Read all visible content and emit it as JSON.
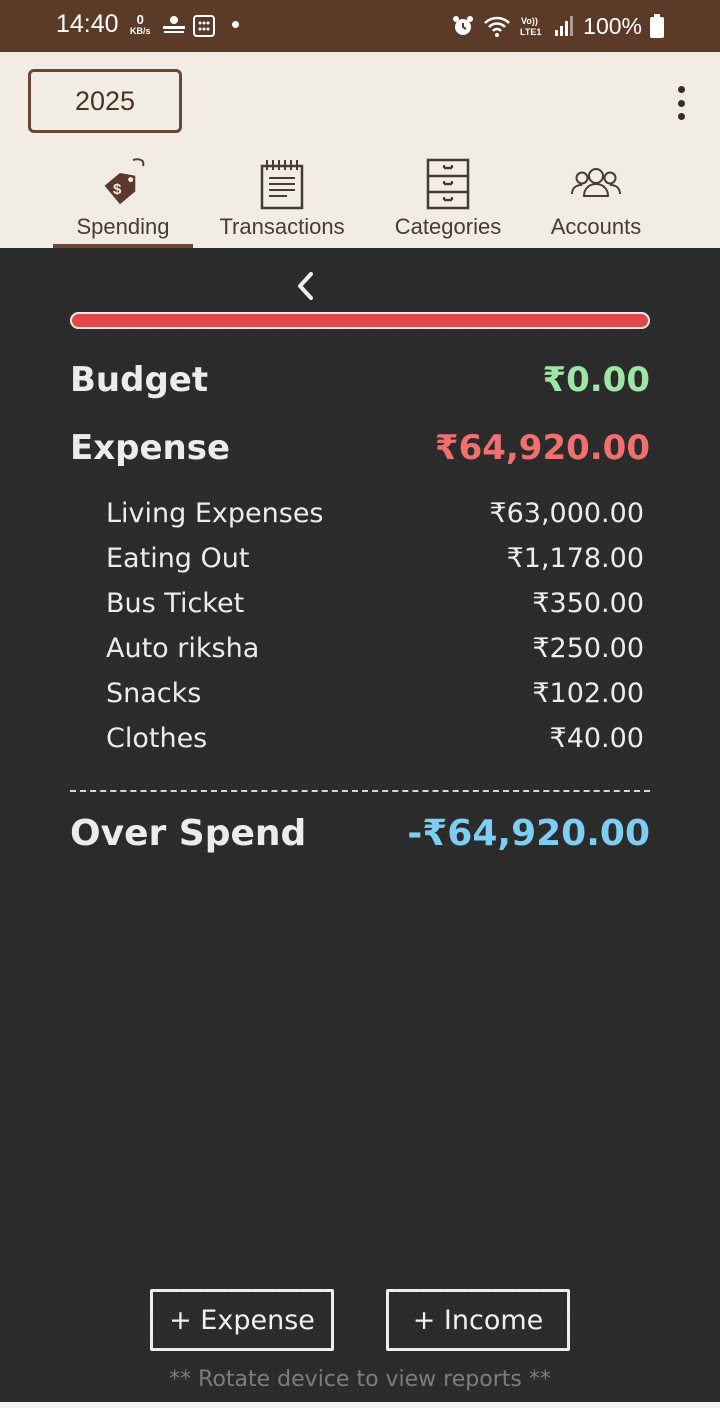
{
  "status": {
    "time": "14:40",
    "net_speed_value": "0",
    "net_speed_unit": "KB/s",
    "battery": "100%"
  },
  "header": {
    "year": "2025",
    "tabs": [
      {
        "label": "Spending",
        "icon": "price-tag-icon",
        "active": true
      },
      {
        "label": "Transactions",
        "icon": "notepad-icon",
        "active": false
      },
      {
        "label": "Categories",
        "icon": "drawers-icon",
        "active": false
      },
      {
        "label": "Accounts",
        "icon": "people-icon",
        "active": false
      }
    ]
  },
  "summary": {
    "budget_label": "Budget",
    "budget_value": "₹0.00",
    "expense_label": "Expense",
    "expense_value": "₹64,920.00",
    "items": [
      {
        "label": "Living Expenses",
        "value": "₹63,000.00"
      },
      {
        "label": "Eating Out",
        "value": "₹1,178.00"
      },
      {
        "label": "Bus Ticket",
        "value": "₹350.00"
      },
      {
        "label": "Auto riksha",
        "value": "₹250.00"
      },
      {
        "label": "Snacks",
        "value": "₹102.00"
      },
      {
        "label": "Clothes",
        "value": "₹40.00"
      }
    ],
    "over_label": "Over Spend",
    "over_value": "-₹64,920.00"
  },
  "actions": {
    "expense_button": "+ Expense",
    "income_button": "+ Income"
  },
  "hint": "** Rotate device to view reports **",
  "colors": {
    "status_bar": "#5b3a28",
    "header_bg": "#f1ede4",
    "board_bg": "#2b2b2b",
    "budget_green": "#9ee6a6",
    "expense_red": "#f07070",
    "over_blue": "#7ecdf2",
    "progress_red": "#e04848"
  }
}
